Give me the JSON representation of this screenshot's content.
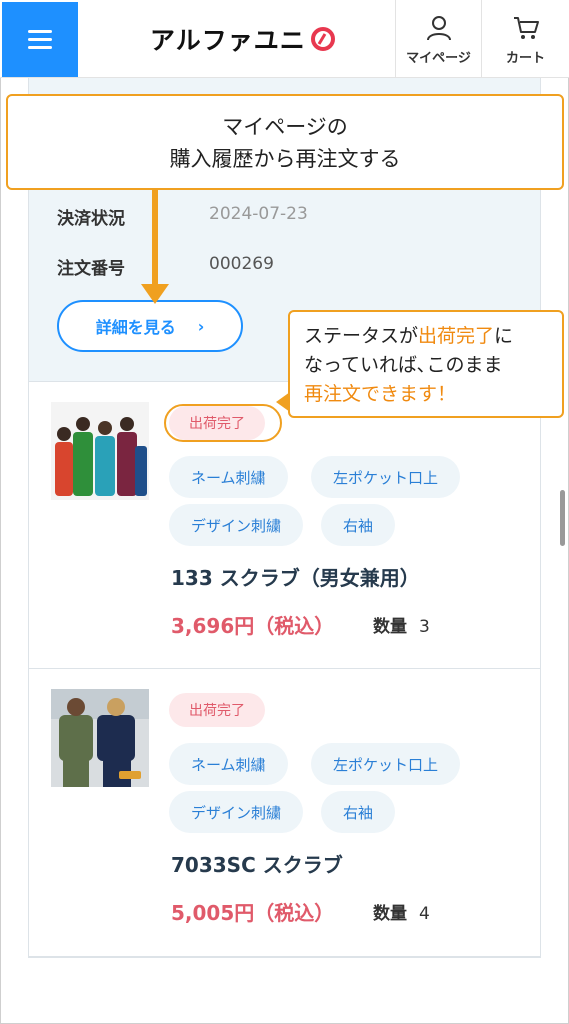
{
  "header": {
    "logo_text": "アルファユニ",
    "mypage_label": "マイページ",
    "cart_label": "カート",
    "menu_icon": "hamburger-icon",
    "mypage_icon": "person-icon",
    "cart_icon": "cart-icon"
  },
  "summary": {
    "payment_label": "決済状況",
    "payment_value": "2024-07-23",
    "order_label": "注文番号",
    "order_value": "000269",
    "detail_button": "詳細を見る",
    "detail_chevron": "›"
  },
  "products": [
    {
      "status": "出荷完了",
      "tags": [
        "ネーム刺繍",
        "左ポケット口上",
        "デザイン刺繍",
        "右袖"
      ],
      "name": "133 スクラブ（男女兼用）",
      "price": "3,696円（税込）",
      "qty_label": "数量",
      "qty": "3"
    },
    {
      "status": "出荷完了",
      "tags": [
        "ネーム刺繍",
        "左ポケット口上",
        "デザイン刺繍",
        "右袖"
      ],
      "name": "7033SC スクラブ",
      "price": "5,005円（税込）",
      "qty_label": "数量",
      "qty": "4"
    }
  ],
  "callouts": {
    "main_line1": "マイページの",
    "main_line2": "購入履歴から再注文する",
    "sub_line1_a": "ステータスが",
    "sub_line1_b": "出荷完了",
    "sub_line1_c": "に",
    "sub_line2": "なっていれば､このまま",
    "sub_line3": "再注文できます！"
  },
  "colors": {
    "accent": "#1e90ff",
    "callout": "#f0a020",
    "price": "#e05a6a",
    "tag_bg": "#eef5f9"
  }
}
